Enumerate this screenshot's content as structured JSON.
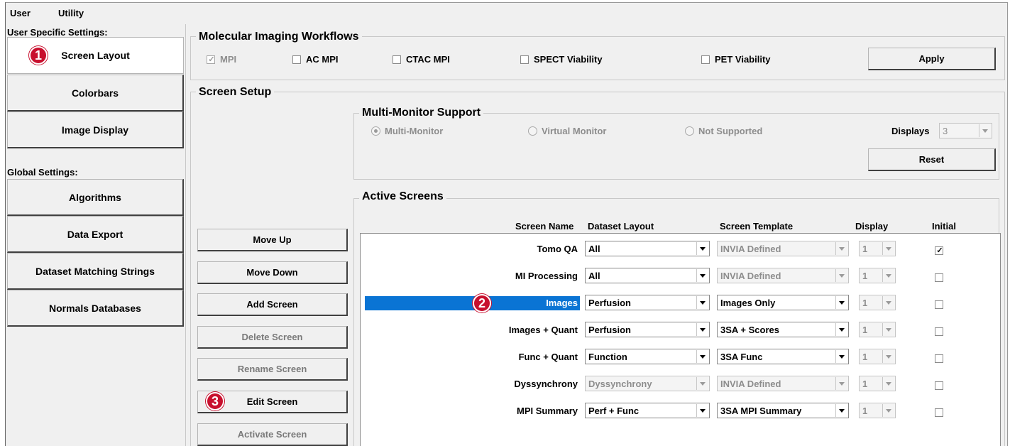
{
  "menu": {
    "user": "User",
    "utility": "Utility"
  },
  "sidebar": {
    "user_section_label": "User Specific Settings:",
    "global_section_label": "Global Settings:",
    "user_items": [
      {
        "label": "Screen Layout",
        "selected": true
      },
      {
        "label": "Colorbars"
      },
      {
        "label": "Image Display"
      }
    ],
    "global_items": [
      {
        "label": "Algorithms"
      },
      {
        "label": "Data Export"
      },
      {
        "label": "Dataset Matching Strings"
      },
      {
        "label": "Normals Databases"
      }
    ]
  },
  "workflows": {
    "title": "Molecular Imaging Workflows",
    "items": [
      {
        "label": "MPI",
        "checked": true,
        "enabled": false
      },
      {
        "label": "AC MPI",
        "checked": false,
        "enabled": true
      },
      {
        "label": "CTAC MPI",
        "checked": false,
        "enabled": true
      },
      {
        "label": "SPECT Viability",
        "checked": false,
        "enabled": true
      },
      {
        "label": "PET Viability",
        "checked": false,
        "enabled": true
      }
    ],
    "apply_label": "Apply"
  },
  "screen_setup": {
    "title": "Screen Setup",
    "buttons": [
      {
        "label": "Move Up",
        "enabled": true
      },
      {
        "label": "Move Down",
        "enabled": true
      },
      {
        "label": "Add Screen",
        "enabled": true
      },
      {
        "label": "Delete Screen",
        "enabled": false
      },
      {
        "label": "Rename Screen",
        "enabled": false
      },
      {
        "label": "Edit Screen",
        "enabled": true
      },
      {
        "label": "Activate Screen",
        "enabled": false
      }
    ]
  },
  "multi_monitor": {
    "title": "Multi-Monitor Support",
    "options": [
      {
        "label": "Multi-Monitor",
        "selected": true
      },
      {
        "label": "Virtual Monitor",
        "selected": false
      },
      {
        "label": "Not Supported",
        "selected": false
      }
    ],
    "displays_label": "Displays",
    "displays_value": "3",
    "reset_label": "Reset"
  },
  "active_screens": {
    "title": "Active Screens",
    "headers": {
      "screen_name": "Screen Name",
      "dataset_layout": "Dataset Layout",
      "screen_template": "Screen Template",
      "display": "Display",
      "initial": "Initial"
    },
    "rows": [
      {
        "name": "Tomo QA",
        "layout": "All",
        "layout_enabled": true,
        "template": "INVIA Defined",
        "template_enabled": false,
        "display": "1",
        "initial": true,
        "selected": false
      },
      {
        "name": "MI Processing",
        "layout": "All",
        "layout_enabled": true,
        "template": "INVIA Defined",
        "template_enabled": false,
        "display": "1",
        "initial": false,
        "selected": false
      },
      {
        "name": "Images",
        "layout": "Perfusion",
        "layout_enabled": true,
        "template": "Images Only",
        "template_enabled": true,
        "display": "1",
        "initial": false,
        "selected": true
      },
      {
        "name": "Images + Quant",
        "layout": "Perfusion",
        "layout_enabled": true,
        "template": "3SA + Scores",
        "template_enabled": true,
        "display": "1",
        "initial": false,
        "selected": false
      },
      {
        "name": "Func + Quant",
        "layout": "Function",
        "layout_enabled": true,
        "template": "3SA Func",
        "template_enabled": true,
        "display": "1",
        "initial": false,
        "selected": false
      },
      {
        "name": "Dyssynchrony",
        "layout": "Dyssynchrony",
        "layout_enabled": false,
        "template": "INVIA Defined",
        "template_enabled": false,
        "display": "1",
        "initial": false,
        "selected": false
      },
      {
        "name": "MPI Summary",
        "layout": "Perf + Func",
        "layout_enabled": true,
        "template": "3SA MPI Summary",
        "template_enabled": true,
        "display": "1",
        "initial": false,
        "selected": false
      }
    ]
  },
  "callouts": [
    "1",
    "2",
    "3"
  ],
  "colors": {
    "selection": "#0a74d4",
    "callout": "#c8102e",
    "panel": "#f0f0f0"
  }
}
